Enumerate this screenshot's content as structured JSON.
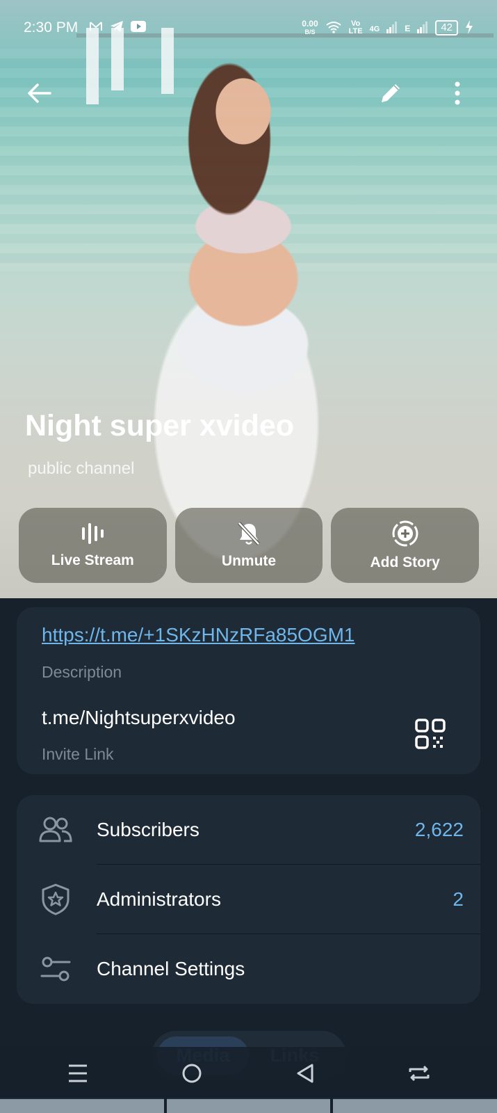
{
  "status_bar": {
    "time": "2:30 PM",
    "left_icons": [
      "gmail-icon",
      "telegram-icon",
      "youtube-icon"
    ],
    "net_speed_value": "0.00",
    "net_speed_unit": "B/S",
    "volte_line1": "Vo",
    "volte_line2": "LTE",
    "network_4g": "4G",
    "network_e": "E",
    "battery": "42"
  },
  "header": {
    "back_icon": "arrow-left-icon",
    "edit_icon": "pencil-icon",
    "more_icon": "more-vertical-icon"
  },
  "channel": {
    "title": "Night super xvideo",
    "subtitle": "public channel"
  },
  "actions": [
    {
      "label": "Live Stream",
      "icon": "live-stream-icon"
    },
    {
      "label": "Unmute",
      "icon": "bell-off-icon"
    },
    {
      "label": "Add Story",
      "icon": "add-story-icon"
    }
  ],
  "info": {
    "description_link": "https://t.me/+1SKzHNzRFa85OGM1",
    "description_label": "Description",
    "invite_link": "t.me/Nightsuperxvideo",
    "invite_label": "Invite Link",
    "qr_icon": "qr-code-icon"
  },
  "list": [
    {
      "label": "Subscribers",
      "value": "2,622",
      "icon": "users-icon"
    },
    {
      "label": "Administrators",
      "value": "2",
      "icon": "shield-star-icon"
    },
    {
      "label": "Channel Settings",
      "value": "",
      "icon": "sliders-icon"
    }
  ],
  "tabs": [
    {
      "label": "Media",
      "active": true
    },
    {
      "label": "Links",
      "active": false
    }
  ],
  "nav": [
    "menu-icon",
    "home-circle-icon",
    "back-triangle-icon",
    "rotate-icon"
  ],
  "colors": {
    "background": "#17212b",
    "card": "#1e2a36",
    "accent": "#6fb6ea",
    "muted": "#7d8b98"
  }
}
